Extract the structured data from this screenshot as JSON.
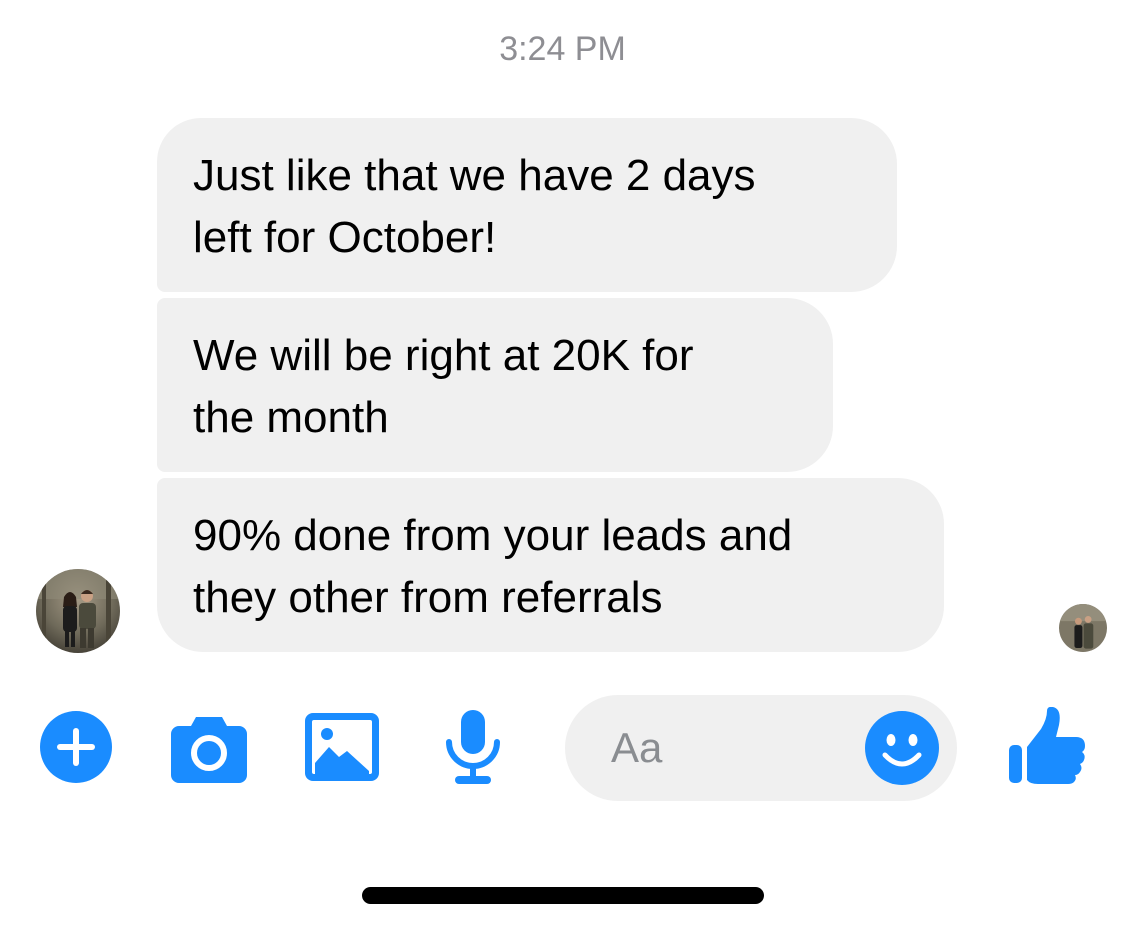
{
  "conversation": {
    "timestamp": "3:24 PM",
    "messages": [
      {
        "lines": [
          "Just like that we have 2 days",
          "left for October!"
        ]
      },
      {
        "lines": [
          "We will be right at 20K for",
          "the month"
        ]
      },
      {
        "lines": [
          "90% done from your leads and",
          "they other from referrals"
        ]
      }
    ]
  },
  "composer": {
    "placeholder": "Aa"
  },
  "icons": {
    "plus": "plus-circle-icon",
    "camera": "camera-icon",
    "photo": "photo-gallery-icon",
    "mic": "microphone-icon",
    "emoji": "smiley-emoji-icon",
    "like": "thumbs-up-icon"
  },
  "colors": {
    "accent": "#1a8cff",
    "bubble": "#f0f0f0",
    "timestamp": "#8e8e93",
    "text": "#000000"
  }
}
